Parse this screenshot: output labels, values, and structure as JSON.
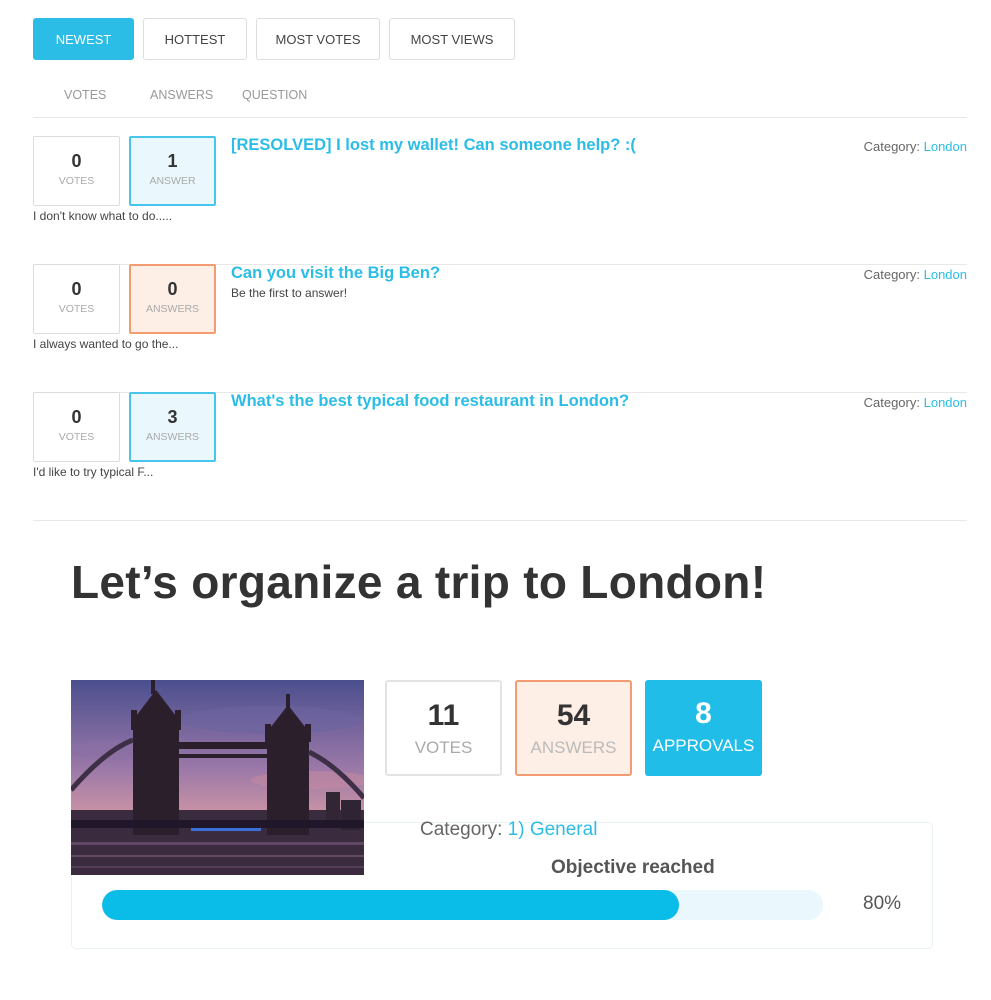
{
  "tabs": [
    {
      "label": "NEWEST",
      "active": true
    },
    {
      "label": "HOTTEST",
      "active": false
    },
    {
      "label": "MOST VOTES",
      "active": false
    },
    {
      "label": "MOST VIEWS",
      "active": false
    }
  ],
  "list_headers": {
    "votes": "VOTES",
    "answers": "ANSWERS",
    "question": "QUESTION"
  },
  "questions": [
    {
      "votes": "0",
      "votes_label": "VOTES",
      "answers": "1",
      "answers_label": "ANSWER",
      "title": "[RESOLVED] I lost my wallet! Can someone help? :(",
      "subtitle": "",
      "excerpt": "I don't know what to do.....",
      "category_label": "Category:",
      "category": "London"
    },
    {
      "votes": "0",
      "votes_label": "VOTES",
      "answers": "0",
      "answers_label": "ANSWERS",
      "title": "Can you visit the Big Ben?",
      "subtitle": "Be the first to answer!",
      "excerpt": "I always wanted to go the...",
      "category_label": "Category:",
      "category": "London"
    },
    {
      "votes": "0",
      "votes_label": "VOTES",
      "answers": "3",
      "answers_label": "ANSWERS",
      "title": "What's the best typical food restaurant in London?",
      "subtitle": "",
      "excerpt": "I'd like to try typical F...",
      "category_label": "Category:",
      "category": "London"
    }
  ],
  "featured": {
    "title": "Let’s organize a trip to London!",
    "votes": "11",
    "votes_label": "VOTES",
    "answers": "54",
    "answers_label": "ANSWERS",
    "approvals": "8",
    "approvals_label": "APPROVALS",
    "category_label": "Category:",
    "category": "1) General",
    "objective_label": "Objective reached",
    "progress_text": "80%",
    "progress_fraction": 0.8
  },
  "colors": {
    "accent": "#2bbde6",
    "answered": "#48c5ea",
    "unanswered": "#f39c72"
  }
}
